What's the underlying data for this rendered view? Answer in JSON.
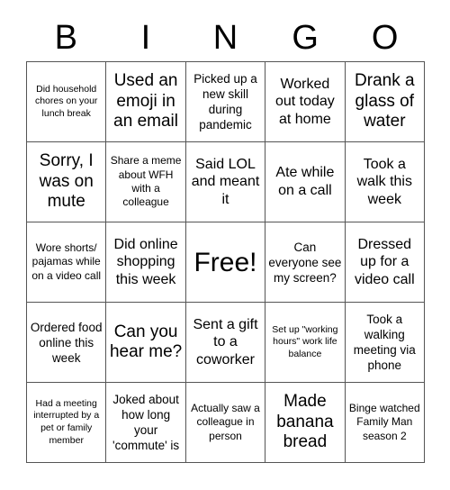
{
  "card": {
    "title": "BINGO",
    "header_letters": [
      "B",
      "I",
      "N",
      "G",
      "O"
    ],
    "columns": 5,
    "rows": 5,
    "free_space": "Free!",
    "free_space_position": "center",
    "border_color": "#555555",
    "text_color": "#000000",
    "background_color": "#ffffff",
    "cells": [
      {
        "text": "Did household chores on your lunch break",
        "size": "xs",
        "row": 1,
        "col": 1
      },
      {
        "text": "Used an emoji in an email",
        "size": "xl",
        "row": 1,
        "col": 2
      },
      {
        "text": "Picked up a new skill during pandemic",
        "size": "md",
        "row": 1,
        "col": 3
      },
      {
        "text": "Worked out today at home",
        "size": "lg",
        "row": 1,
        "col": 4
      },
      {
        "text": "Drank a glass of water",
        "size": "xl",
        "row": 1,
        "col": 5
      },
      {
        "text": "Sorry, I was on mute",
        "size": "xl",
        "row": 2,
        "col": 1
      },
      {
        "text": "Share a meme about WFH with a colleague",
        "size": "sm",
        "row": 2,
        "col": 2
      },
      {
        "text": "Said LOL and meant it",
        "size": "lg",
        "row": 2,
        "col": 3
      },
      {
        "text": "Ate while on a call",
        "size": "lg",
        "row": 2,
        "col": 4
      },
      {
        "text": "Took a walk this week",
        "size": "lg",
        "row": 2,
        "col": 5
      },
      {
        "text": "Wore shorts/ pajamas while on a video call",
        "size": "sm",
        "row": 3,
        "col": 1
      },
      {
        "text": "Did online shopping this week",
        "size": "lg",
        "row": 3,
        "col": 2
      },
      {
        "text": "Free!",
        "size": "free",
        "row": 3,
        "col": 3
      },
      {
        "text": "Can everyone see my screen?",
        "size": "md",
        "row": 3,
        "col": 4
      },
      {
        "text": "Dressed up for a video call",
        "size": "lg",
        "row": 3,
        "col": 5
      },
      {
        "text": "Ordered food online this week",
        "size": "md",
        "row": 4,
        "col": 1
      },
      {
        "text": "Can you hear me?",
        "size": "xl",
        "row": 4,
        "col": 2
      },
      {
        "text": "Sent a gift to a coworker",
        "size": "lg",
        "row": 4,
        "col": 3
      },
      {
        "text": "Set up \"working hours\" work life balance",
        "size": "xs",
        "row": 4,
        "col": 4
      },
      {
        "text": "Took a walking meeting via phone",
        "size": "md",
        "row": 4,
        "col": 5
      },
      {
        "text": "Had a meeting interrupted by a pet or family member",
        "size": "xs",
        "row": 5,
        "col": 1
      },
      {
        "text": "Joked about how long your 'commute' is",
        "size": "md",
        "row": 5,
        "col": 2
      },
      {
        "text": "Actually saw a colleague in person",
        "size": "sm",
        "row": 5,
        "col": 3
      },
      {
        "text": "Made banana bread",
        "size": "xl",
        "row": 5,
        "col": 4
      },
      {
        "text": "Binge watched Family Man season 2",
        "size": "sm",
        "row": 5,
        "col": 5
      }
    ]
  }
}
